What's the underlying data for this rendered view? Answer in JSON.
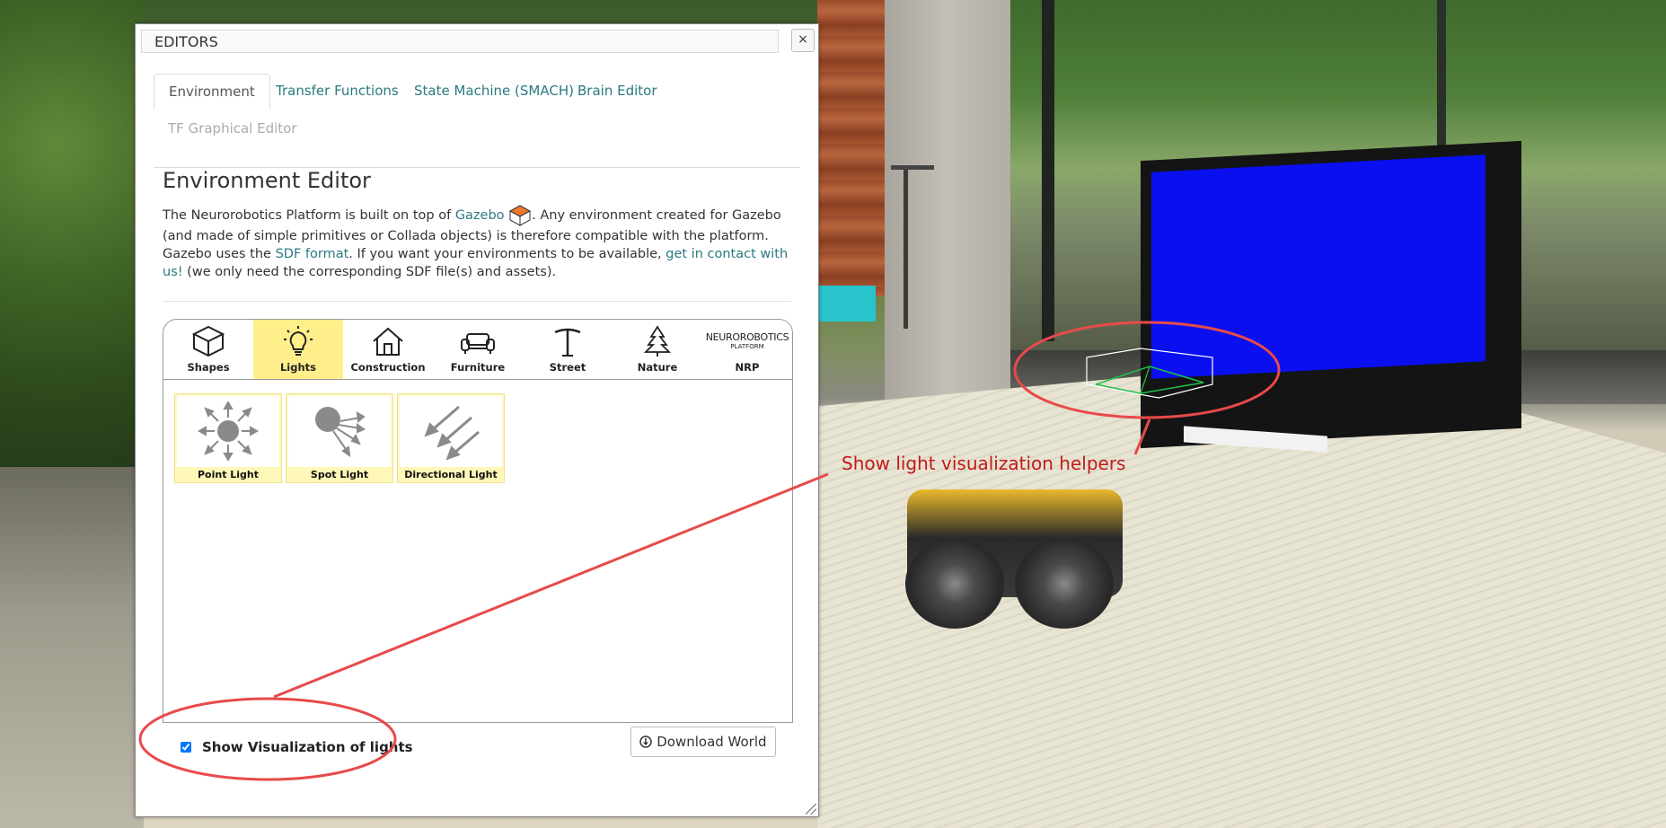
{
  "dialog": {
    "title": "EDITORS",
    "close_label": "×"
  },
  "tabs": [
    {
      "label": "Environment",
      "state": "active"
    },
    {
      "label": "Transfer Functions",
      "state": "normal"
    },
    {
      "label": "State Machine (SMACH)",
      "state": "normal"
    },
    {
      "label": "Brain Editor",
      "state": "normal"
    },
    {
      "label": "TF Graphical Editor",
      "state": "disabled"
    }
  ],
  "environment_editor": {
    "title": "Environment Editor",
    "desc": {
      "p1": "The Neurorobotics Platform is built on top of ",
      "gazebo_link": "Gazebo",
      "p2": ". Any environment created for Gazebo (and made of simple primitives or Collada objects) is therefore compatible with the platform. Gazebo uses the ",
      "sdf_link": "SDF format",
      "p3": ". If you want your environments to be available, ",
      "contact_link": "get in contact with us!",
      "p4": " (we only need the corresponding SDF file(s) and assets)."
    }
  },
  "categories": [
    {
      "label": "Shapes",
      "icon": "cube-icon"
    },
    {
      "label": "Lights",
      "icon": "lightbulb-icon",
      "active": true
    },
    {
      "label": "Construction",
      "icon": "house-icon"
    },
    {
      "label": "Furniture",
      "icon": "sofa-icon"
    },
    {
      "label": "Street",
      "icon": "street-lamp-icon"
    },
    {
      "label": "Nature",
      "icon": "tree-icon"
    },
    {
      "label": "NRP",
      "icon": "nrp-logo",
      "logo_top": "NEUROROBOTICS",
      "logo_bottom": "PLATFORM"
    }
  ],
  "items": [
    {
      "label": "Point Light",
      "icon": "point-light-icon"
    },
    {
      "label": "Spot Light",
      "icon": "spot-light-icon"
    },
    {
      "label": "Directional Light",
      "icon": "directional-light-icon"
    }
  ],
  "visualization": {
    "label": "Show Visualization of lights",
    "checked": true
  },
  "download": {
    "label": "Download World",
    "icon": "download-circle-icon"
  },
  "annotation": {
    "label": "Show light visualization helpers",
    "color": "#e84a4a"
  },
  "colors": {
    "accent": "#2a7a7f",
    "active_category": "#ffef8a",
    "tv_screen": "#0a0ff0"
  }
}
